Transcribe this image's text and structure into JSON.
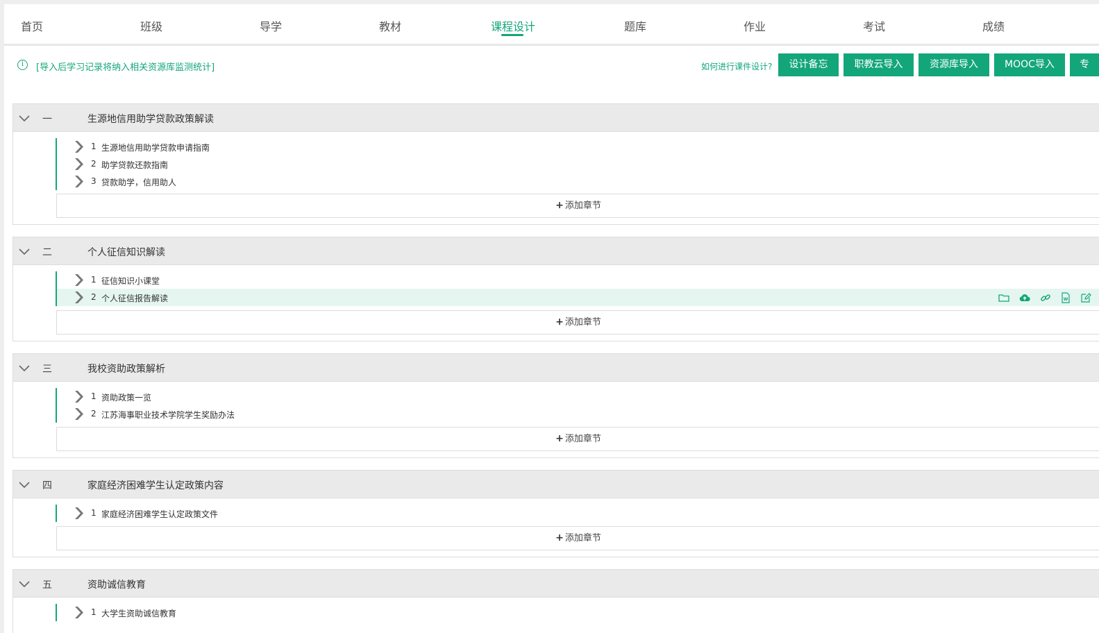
{
  "nav": {
    "items": [
      "首页",
      "班级",
      "导学",
      "教材",
      "课程设计",
      "题库",
      "作业",
      "考试",
      "成绩"
    ],
    "active": "课程设计"
  },
  "toolbar": {
    "notice": "[导入后学习记录将纳入相关资源库监测统计]",
    "howto": "如何进行课件设计?",
    "buttons": [
      "设计备忘",
      "职教云导入",
      "资源库导入",
      "MOOC导入",
      "专"
    ]
  },
  "add_section_label": "添加章节",
  "chapters": [
    {
      "num": "一",
      "title": "生源地信用助学贷款政策解读",
      "sections": [
        {
          "num": "1",
          "title": "生源地信用助学贷款申请指南"
        },
        {
          "num": "2",
          "title": "助学贷款还款指南"
        },
        {
          "num": "3",
          "title": "贷款助学，信用助人"
        }
      ]
    },
    {
      "num": "二",
      "title": "个人征信知识解读",
      "sections": [
        {
          "num": "1",
          "title": "征信知识小课堂"
        },
        {
          "num": "2",
          "title": "个人征信报告解读"
        }
      ]
    },
    {
      "num": "三",
      "title": "我校资助政策解析",
      "sections": [
        {
          "num": "1",
          "title": "资助政策一览"
        },
        {
          "num": "2",
          "title": "江苏海事职业技术学院学生奖励办法"
        }
      ]
    },
    {
      "num": "四",
      "title": "家庭经济困难学生认定政策内容",
      "sections": [
        {
          "num": "1",
          "title": "家庭经济困难学生认定政策文件"
        }
      ]
    },
    {
      "num": "五",
      "title": "资助诚信教育",
      "sections": [
        {
          "num": "1",
          "title": "大学生资助诚信教育"
        }
      ]
    }
  ],
  "row_tool_icons": [
    "folder-icon",
    "cloud-upload-icon",
    "link-icon",
    "word-doc-icon",
    "edit-icon"
  ],
  "colors": {
    "accent": "#13a67a",
    "header_bg": "#eaeaea",
    "highlight_row": "#e5f6f0"
  }
}
